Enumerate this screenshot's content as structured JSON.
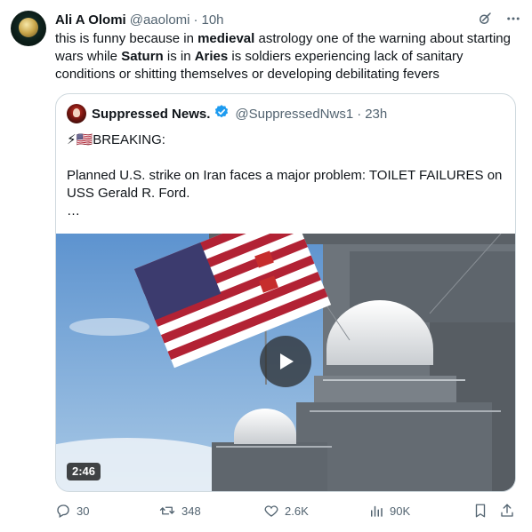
{
  "tweet": {
    "author_name": "Ali A Olomi",
    "author_handle": "@aaolomi",
    "separator": "·",
    "time": "10h",
    "text_segments": [
      "this is funny because in ",
      "medieval",
      " astrology one of the warning about starting wars while ",
      "Saturn",
      " is in ",
      "Aries",
      " is soldiers experiencing lack of sanitary conditions or shitting themselves or developing debilitating fevers"
    ]
  },
  "quote": {
    "author_name": "Suppressed News.",
    "author_handle": "@SuppressedNws1",
    "separator": "·",
    "time": "23h",
    "line1_emoji": "⚡🇺🇸",
    "line1_text": "BREAKING:",
    "line2": "Planned U.S. strike on Iran faces a major problem: TOILET FAILURES on USS Gerald R. Ford.",
    "line3": "…",
    "video_duration": "2:46"
  },
  "actions": {
    "replies": "30",
    "reposts": "348",
    "likes": "2.6K",
    "views": "90K"
  },
  "icons": {
    "header": [
      "grok-icon",
      "more-icon"
    ],
    "actions": [
      "reply-icon",
      "repost-icon",
      "like-icon",
      "views-icon",
      "bookmark-icon",
      "share-icon"
    ]
  },
  "colors": {
    "verified": "#1d9bf0",
    "secondary_text": "#536471",
    "border": "#cfd9de"
  }
}
